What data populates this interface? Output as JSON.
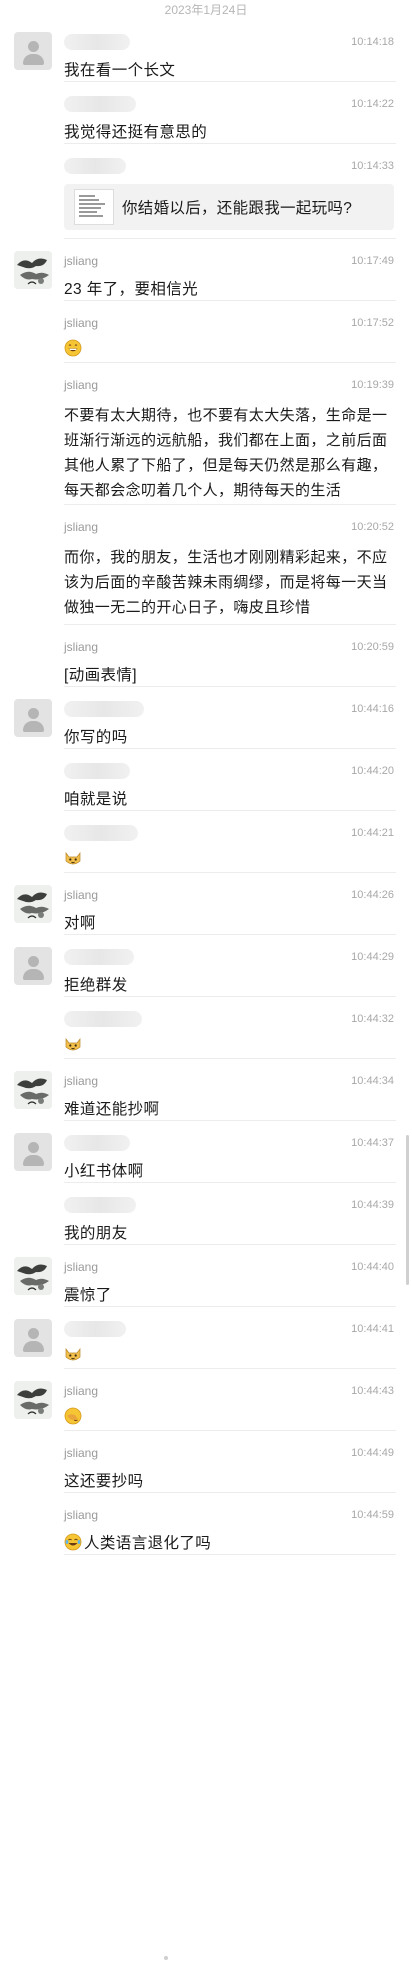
{
  "date_header": "2023年1月24日",
  "messages": [
    {
      "avatar": "default",
      "sender": "",
      "time": "10:14:18",
      "text": "我在看一个长文",
      "h": 62
    },
    {
      "avatar": "none",
      "sender": "",
      "time": "10:14:22",
      "text": "我觉得还挺有意思的",
      "h": 62
    },
    {
      "avatar": "none",
      "sender": "",
      "time": "10:14:33",
      "kind": "quote",
      "text": "你结婚以后，还能跟我一起玩吗?",
      "h": 95
    },
    {
      "avatar": "jsliang",
      "sender": "jsliang",
      "time": "10:17:49",
      "text": "23 年了，要相信光",
      "h": 62
    },
    {
      "avatar": "none",
      "sender": "jsliang",
      "time": "10:17:52",
      "emoji": [
        "grin"
      ],
      "h": 62
    },
    {
      "avatar": "none",
      "sender": "jsliang",
      "time": "10:19:39",
      "long": true,
      "text": "不要有太大期待，也不要有太大失落，生命是一班渐行渐远的远航船，我们都在上面，之前后面其他人累了下船了，但是每天仍然是那么有趣，每天都会念叨着几个人，期待每天的生活",
      "h": 142
    },
    {
      "avatar": "none",
      "sender": "jsliang",
      "time": "10:20:52",
      "long": true,
      "text": "而你，我的朋友，生活也才刚刚精彩起来，不应该为后面的辛酸苦辣未雨绸缪，而是将每一天当做独一无二的开心日子，嗨皮且珍惜",
      "h": 120
    },
    {
      "avatar": "none",
      "sender": "jsliang",
      "time": "10:20:59",
      "text": "[动画表情]",
      "h": 62
    },
    {
      "avatar": "default",
      "sender": "",
      "time": "10:44:16",
      "text": "你写的吗",
      "h": 62
    },
    {
      "avatar": "none",
      "sender": "",
      "time": "10:44:20",
      "text": "咱就是说",
      "h": 62
    },
    {
      "avatar": "none",
      "sender": "",
      "time": "10:44:21",
      "emoji": [
        "cat"
      ],
      "h": 62
    },
    {
      "avatar": "jsliang",
      "sender": "jsliang",
      "time": "10:44:26",
      "text": "对啊",
      "h": 62
    },
    {
      "avatar": "default",
      "sender": "",
      "time": "10:44:29",
      "text": "拒绝群发",
      "h": 62
    },
    {
      "avatar": "none",
      "sender": "",
      "time": "10:44:32",
      "emoji": [
        "cat"
      ],
      "h": 62
    },
    {
      "avatar": "jsliang",
      "sender": "jsliang",
      "time": "10:44:34",
      "text": "难道还能抄啊",
      "h": 62
    },
    {
      "avatar": "default",
      "sender": "",
      "time": "10:44:37",
      "text": "小红书体啊",
      "h": 62
    },
    {
      "avatar": "none",
      "sender": "",
      "time": "10:44:39",
      "text": "我的朋友",
      "h": 62
    },
    {
      "avatar": "jsliang",
      "sender": "jsliang",
      "time": "10:44:40",
      "text": "震惊了",
      "h": 62
    },
    {
      "avatar": "default",
      "sender": "",
      "time": "10:44:41",
      "emoji": [
        "cat"
      ],
      "h": 62
    },
    {
      "avatar": "jsliang",
      "sender": "jsliang",
      "time": "10:44:43",
      "emoji": [
        "facepalm"
      ],
      "h": 62
    },
    {
      "avatar": "none",
      "sender": "jsliang",
      "time": "10:44:49",
      "text": "这还要抄吗",
      "h": 62
    },
    {
      "avatar": "none",
      "sender": "jsliang",
      "time": "10:44:59",
      "emoji": [
        "joy"
      ],
      "text": "人类语言退化了吗",
      "h": 62
    }
  ],
  "icons": {
    "default_avatar": "person-silhouette-icon",
    "jsliang_avatar": "ink-painting-avatar"
  }
}
